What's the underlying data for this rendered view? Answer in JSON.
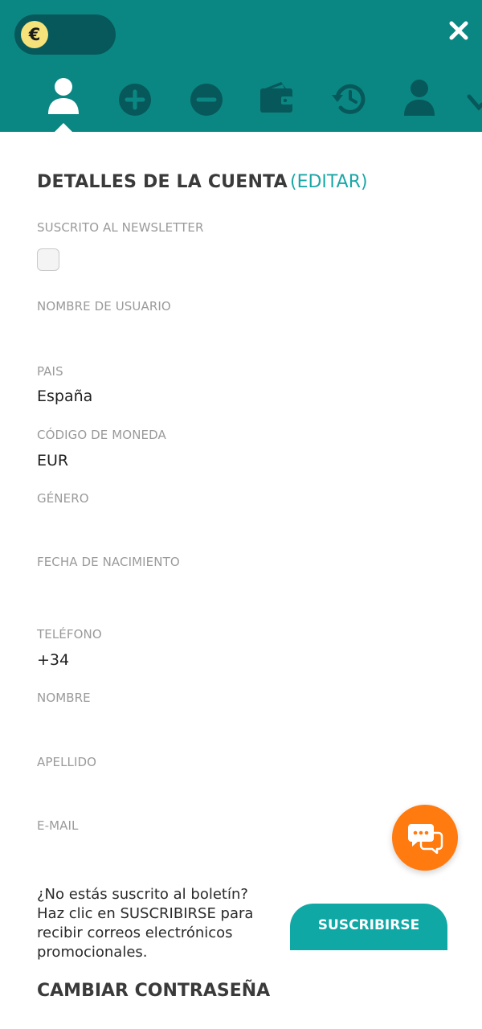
{
  "header": {
    "balance_symbol": "€",
    "colors": {
      "header_bg": "#0b8783",
      "pill_bg": "#07585a",
      "icon": "#07585a",
      "active_icon": "#ffffff"
    },
    "tabs": [
      {
        "icon": "user-icon",
        "active": true
      },
      {
        "icon": "plus-circle-icon",
        "active": false
      },
      {
        "icon": "minus-circle-icon",
        "active": false
      },
      {
        "icon": "wallet-icon",
        "active": false
      },
      {
        "icon": "history-icon",
        "active": false
      },
      {
        "icon": "user-icon",
        "active": false
      },
      {
        "icon": "chevron-icon",
        "active": false
      }
    ]
  },
  "account": {
    "title": "DETALLES DE LA CUENTA",
    "edit_label": "(EDITAR)",
    "fields": {
      "newsletter_label": "SUSCRITO AL NEWSLETTER",
      "username_label": "NOMBRE DE USUARIO",
      "country_label": "PAIS",
      "country_value": "España",
      "currency_label": "CÓDIGO DE MONEDA",
      "currency_value": "EUR",
      "gender_label": "GÉNERO",
      "birthdate_label": "FECHA DE NACIMIENTO",
      "phone_label": "TELÉFONO",
      "phone_value": "+34",
      "firstname_label": "NOMBRE",
      "lastname_label": "APELLIDO",
      "email_label": "E-MAIL"
    },
    "newsletter_checked": false
  },
  "promo": {
    "text": "¿No estás suscrito al boletín? Haz clic en SUSCRIBIRSE para recibir correos electrónicos promocionales.",
    "subscribe_label": "SUSCRIBIRSE"
  },
  "password": {
    "title": "CAMBIAR CONTRASEÑA"
  },
  "colors": {
    "accent": "#1ba7a7",
    "button": "#10a8a5",
    "chat": "#ff7b0f"
  }
}
